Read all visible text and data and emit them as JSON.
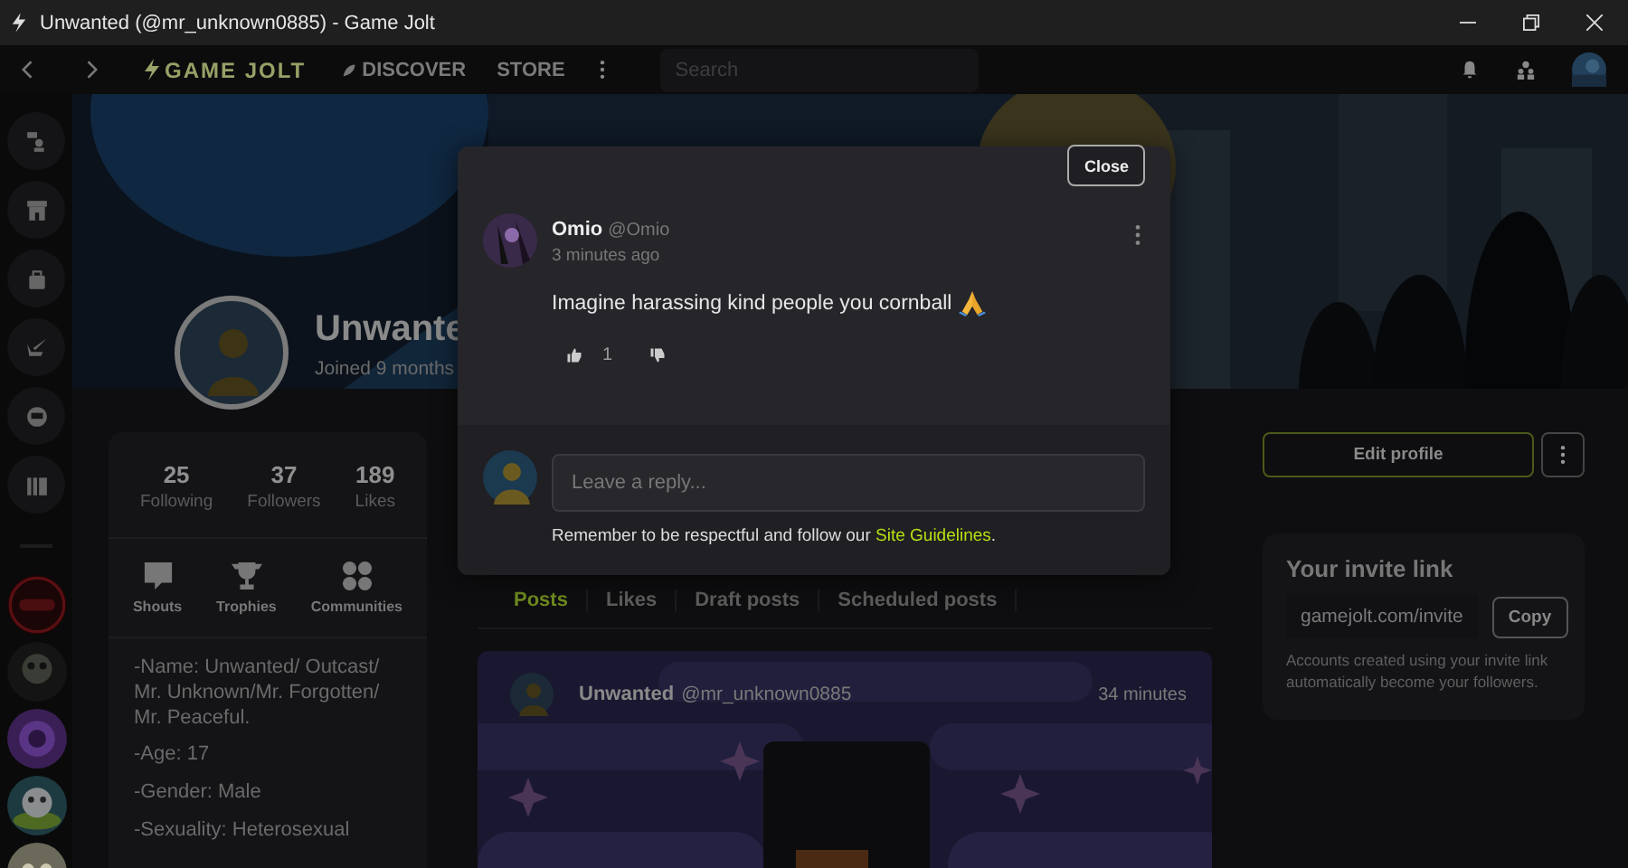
{
  "window": {
    "title": "Unwanted (@mr_unknown0885) - Game Jolt"
  },
  "nav": {
    "logo": "GAME JOLT",
    "links": [
      "DISCOVER",
      "STORE"
    ],
    "search": {
      "placeholder": "Search"
    }
  },
  "profile": {
    "name": "Unwante",
    "joined": "Joined 9 months",
    "stats": [
      {
        "value": "25",
        "label": "Following"
      },
      {
        "value": "37",
        "label": "Followers"
      },
      {
        "value": "189",
        "label": "Likes"
      }
    ],
    "shortcuts": [
      {
        "kind": "shouts",
        "label": "Shouts"
      },
      {
        "kind": "trophies",
        "label": "Trophies"
      },
      {
        "kind": "communities",
        "label": "Communities"
      }
    ],
    "bio": [
      "-Name: Unwanted/ Outcast/ Mr. Unknown/Mr. Forgotten/ Mr. Peaceful.",
      "-Age: 17",
      "-Gender: Male",
      "-Sexuality: Heterosexual"
    ]
  },
  "tabs": [
    {
      "label": "Posts",
      "selected": true
    },
    {
      "label": "Likes",
      "selected": false
    },
    {
      "label": "Draft posts",
      "selected": false
    },
    {
      "label": "Scheduled posts",
      "selected": false
    }
  ],
  "post": {
    "author": "Unwanted",
    "handle": "@mr_unknown0885",
    "time": "34 minutes"
  },
  "edit_button": "Edit profile",
  "invite": {
    "title": "Your invite link",
    "link": "gamejolt.com/invite",
    "copy": "Copy",
    "note": "Accounts created using your invite link automatically become your followers."
  },
  "modal": {
    "close": "Close",
    "comment": {
      "author": "Omio",
      "handle": "@Omio",
      "time": "3 minutes ago",
      "text": "Imagine harassing kind people you cornball",
      "likes": "1"
    },
    "reply": {
      "placeholder": "Leave a reply...",
      "notice": "Remember to be respectful and follow our ",
      "link": "Site Guidelines",
      "notice_end": "."
    }
  }
}
